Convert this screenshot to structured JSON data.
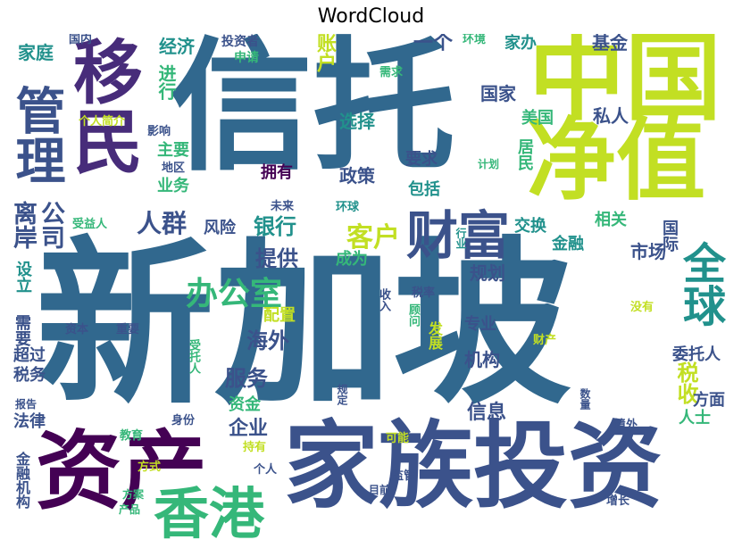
{
  "title": "WordCloud",
  "words": [
    {
      "text": "新加坡",
      "color": "#31688e"
    },
    {
      "text": "信托",
      "color": "#31688e"
    },
    {
      "text": "中国",
      "color": "#c2df23"
    },
    {
      "text": "家族投资",
      "color": "#3b528b"
    },
    {
      "text": "净值",
      "color": "#c2df23"
    },
    {
      "text": "移民",
      "color": "#472c7a"
    },
    {
      "text": "资产",
      "color": "#440154"
    },
    {
      "text": "香港",
      "color": "#35b779"
    },
    {
      "text": "财富",
      "color": "#3b528b"
    },
    {
      "text": "管理",
      "color": "#3b528b"
    },
    {
      "text": "全球",
      "color": "#21918c"
    },
    {
      "text": "办公室",
      "color": "#35b779"
    },
    {
      "text": "客户",
      "color": "#c2df23"
    },
    {
      "text": "人群",
      "color": "#3b528b"
    },
    {
      "text": "离岸",
      "color": "#3b528b"
    },
    {
      "text": "公司",
      "color": "#3b528b"
    },
    {
      "text": "银行",
      "color": "#21918c"
    },
    {
      "text": "提供",
      "color": "#3b528b"
    },
    {
      "text": "海外",
      "color": "#3b528b"
    },
    {
      "text": "服务",
      "color": "#3b528b"
    },
    {
      "text": "税收",
      "color": "#c2df23"
    },
    {
      "text": "企业",
      "color": "#3b528b"
    },
    {
      "text": "信息",
      "color": "#3b528b"
    },
    {
      "text": "机构",
      "color": "#3b528b"
    },
    {
      "text": "家庭",
      "color": "#21918c"
    },
    {
      "text": "经济",
      "color": "#21918c"
    },
    {
      "text": "进行",
      "color": "#35b779"
    },
    {
      "text": "账户",
      "color": "#c2df23"
    },
    {
      "text": "一个",
      "color": "#3b528b"
    },
    {
      "text": "家办",
      "color": "#21918c"
    },
    {
      "text": "基金",
      "color": "#3b528b"
    },
    {
      "text": "国家",
      "color": "#3b528b"
    },
    {
      "text": "选择",
      "color": "#21918c"
    },
    {
      "text": "美国",
      "color": "#35b779"
    },
    {
      "text": "私人",
      "color": "#3b528b"
    },
    {
      "text": "主要",
      "color": "#35b779"
    },
    {
      "text": "业务",
      "color": "#35b779"
    },
    {
      "text": "拥有",
      "color": "#440154"
    },
    {
      "text": "政策",
      "color": "#3b528b"
    },
    {
      "text": "要求",
      "color": "#3b528b"
    },
    {
      "text": "居民",
      "color": "#35b779"
    },
    {
      "text": "包括",
      "color": "#21918c"
    },
    {
      "text": "风险",
      "color": "#3b528b"
    },
    {
      "text": "相关",
      "color": "#35b779"
    },
    {
      "text": "交换",
      "color": "#21918c"
    },
    {
      "text": "金融",
      "color": "#21918c"
    },
    {
      "text": "国际",
      "color": "#3b528b"
    },
    {
      "text": "市场",
      "color": "#3b528b"
    },
    {
      "text": "成为",
      "color": "#35b779"
    },
    {
      "text": "规划",
      "color": "#3b528b"
    },
    {
      "text": "设立",
      "color": "#21918c"
    },
    {
      "text": "需要",
      "color": "#3b528b"
    },
    {
      "text": "超过",
      "color": "#3b528b"
    },
    {
      "text": "税务",
      "color": "#3b528b"
    },
    {
      "text": "法律",
      "color": "#3b528b"
    },
    {
      "text": "配置",
      "color": "#c2df23"
    },
    {
      "text": "专业",
      "color": "#3b528b"
    },
    {
      "text": "资金",
      "color": "#35b779"
    },
    {
      "text": "委托人",
      "color": "#3b528b"
    },
    {
      "text": "方面",
      "color": "#3b528b"
    },
    {
      "text": "人士",
      "color": "#35b779"
    },
    {
      "text": "金融机构",
      "color": "#3b528b"
    },
    {
      "text": "发展",
      "color": "#c2df23"
    },
    {
      "text": "投资者",
      "color": "#3b528b"
    },
    {
      "text": "申请",
      "color": "#35b779"
    },
    {
      "text": "需求",
      "color": "#35b779"
    },
    {
      "text": "国内",
      "color": "#3b528b"
    },
    {
      "text": "环境",
      "color": "#35b779"
    },
    {
      "text": "个人简介",
      "color": "#c2df23"
    },
    {
      "text": "影响",
      "color": "#3b528b"
    },
    {
      "text": "地区",
      "color": "#3b528b"
    },
    {
      "text": "计划",
      "color": "#35b779"
    },
    {
      "text": "未来",
      "color": "#3b528b"
    },
    {
      "text": "受益人",
      "color": "#35b779"
    },
    {
      "text": "环球",
      "color": "#21918c"
    },
    {
      "text": "行业",
      "color": "#21918c"
    },
    {
      "text": "收入",
      "color": "#3b528b"
    },
    {
      "text": "税率",
      "color": "#3b528b"
    },
    {
      "text": "顾问",
      "color": "#35b779"
    },
    {
      "text": "没有",
      "color": "#c2df23"
    },
    {
      "text": "资本",
      "color": "#3b528b"
    },
    {
      "text": "重要",
      "color": "#3b528b"
    },
    {
      "text": "受托人",
      "color": "#35b779"
    },
    {
      "text": "财产",
      "color": "#c2df23"
    },
    {
      "text": "报告",
      "color": "#3b528b"
    },
    {
      "text": "规定",
      "color": "#3b528b"
    },
    {
      "text": "身份",
      "color": "#3b528b"
    },
    {
      "text": "数量",
      "color": "#3b528b"
    },
    {
      "text": "教育",
      "color": "#35b779"
    },
    {
      "text": "境外",
      "color": "#3b528b"
    },
    {
      "text": "持有",
      "color": "#c2df23"
    },
    {
      "text": "可能",
      "color": "#c2df23"
    },
    {
      "text": "方式",
      "color": "#c2df23"
    },
    {
      "text": "个人",
      "color": "#3b528b"
    },
    {
      "text": "监管",
      "color": "#3b528b"
    },
    {
      "text": "目前",
      "color": "#3b528b"
    },
    {
      "text": "方案",
      "color": "#35b779"
    },
    {
      "text": "产品",
      "color": "#35b779"
    },
    {
      "text": "增长",
      "color": "#3b528b"
    }
  ]
}
